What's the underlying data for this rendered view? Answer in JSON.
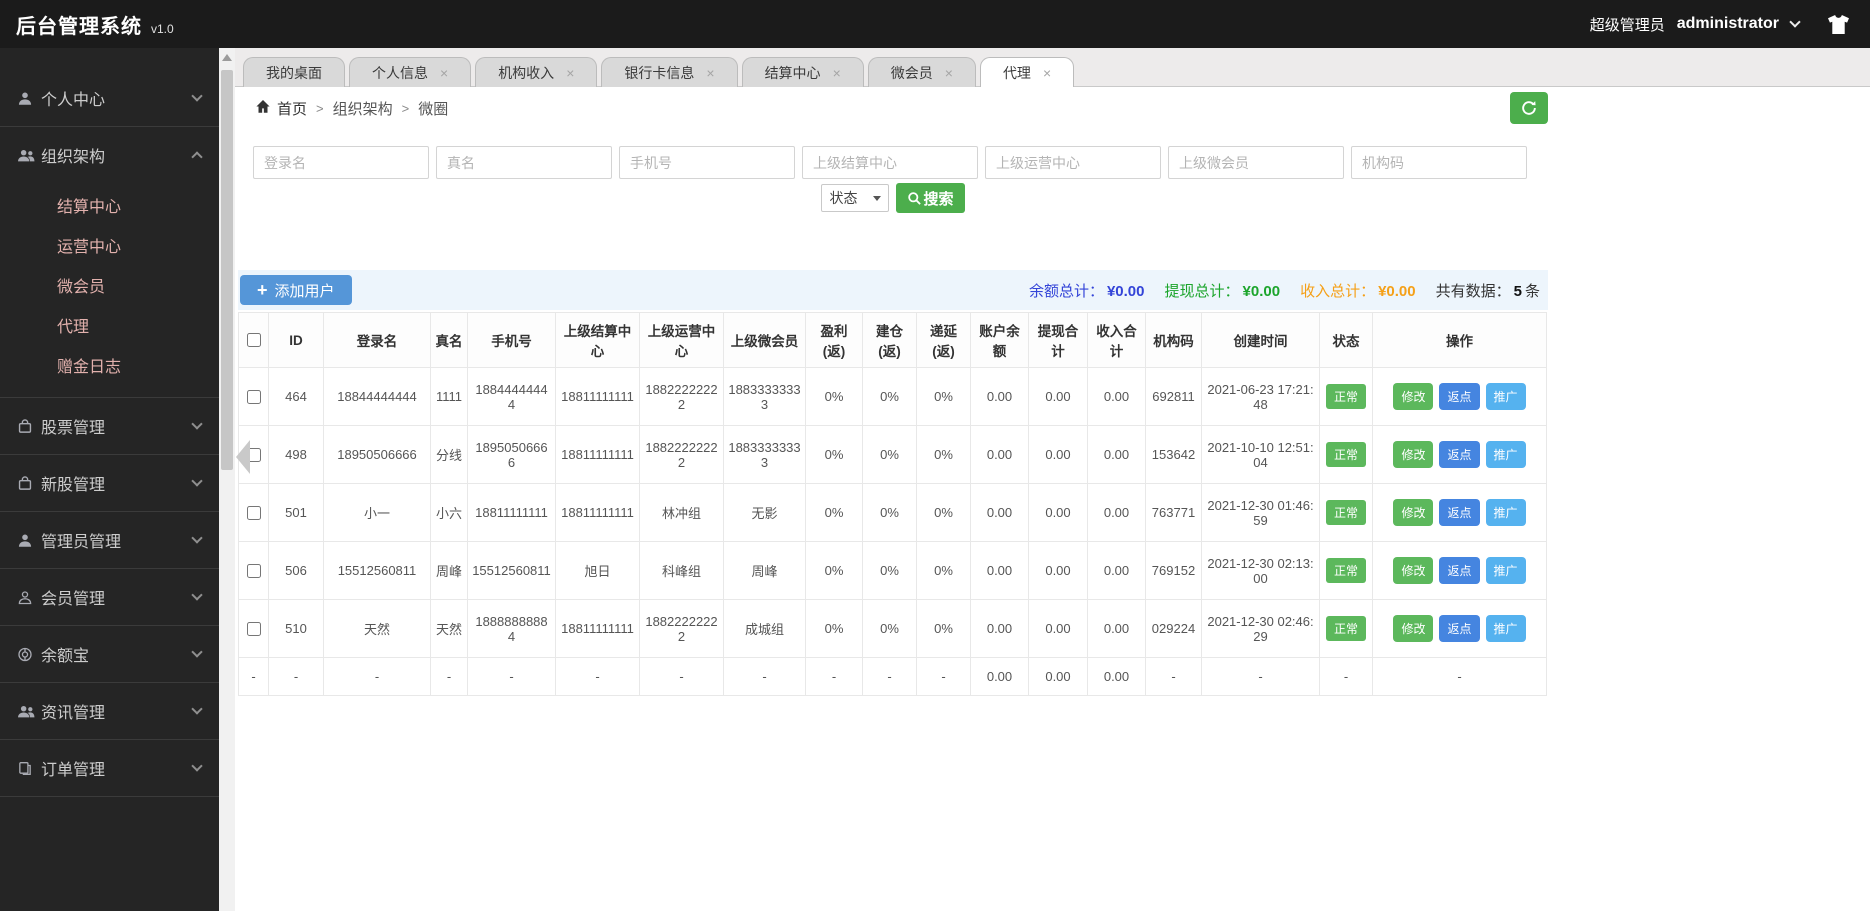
{
  "header": {
    "title": "后台管理系统",
    "version": "v1.0",
    "role": "超级管理员",
    "username": "administrator"
  },
  "sidebar": {
    "items": [
      {
        "label": "个人中心",
        "icon": "user-icon",
        "expanded": false
      },
      {
        "label": "组织架构",
        "icon": "users-icon",
        "expanded": true,
        "children": [
          "结算中心",
          "运营中心",
          "微会员",
          "代理",
          "赠金日志"
        ]
      },
      {
        "label": "股票管理",
        "icon": "bag-icon",
        "expanded": false
      },
      {
        "label": "新股管理",
        "icon": "bag-icon",
        "expanded": false
      },
      {
        "label": "管理员管理",
        "icon": "admin-user-icon",
        "expanded": false
      },
      {
        "label": "会员管理",
        "icon": "member-icon",
        "expanded": false
      },
      {
        "label": "余额宝",
        "icon": "wallet-icon",
        "expanded": false
      },
      {
        "label": "资讯管理",
        "icon": "news-icon",
        "expanded": false
      },
      {
        "label": "订单管理",
        "icon": "order-icon",
        "expanded": false
      }
    ]
  },
  "tabs": {
    "items": [
      {
        "label": "我的桌面",
        "closable": false,
        "active": false
      },
      {
        "label": "个人信息",
        "closable": true,
        "active": false
      },
      {
        "label": "机构收入",
        "closable": true,
        "active": false
      },
      {
        "label": "银行卡信息",
        "closable": true,
        "active": false
      },
      {
        "label": "结算中心",
        "closable": true,
        "active": false
      },
      {
        "label": "微会员",
        "closable": true,
        "active": false
      },
      {
        "label": "代理",
        "closable": true,
        "active": true
      }
    ]
  },
  "breadcrumb": {
    "home": "首页",
    "items": [
      "组织架构",
      "微圈"
    ]
  },
  "filters": {
    "placeholders": [
      "登录名",
      "真名",
      "手机号",
      "上级结算中心",
      "上级运营中心",
      "上级微会员",
      "机构码"
    ],
    "status_label": "状态",
    "search_label": "搜索"
  },
  "toolbar": {
    "add_user_plus": "+",
    "add_user_label": "添加用户",
    "stats": [
      {
        "label": "余额总计：",
        "value": "¥0.00",
        "color": "#3344d8"
      },
      {
        "label": "提现总计：",
        "value": "¥0.00",
        "color": "#1ca52c"
      },
      {
        "label": "收入总计：",
        "value": "¥0.00",
        "color": "#f5a018"
      }
    ],
    "total": {
      "label": "共有数据：",
      "value": "5",
      "unit": "条"
    }
  },
  "table": {
    "headers": [
      "ID",
      "登录名",
      "真名",
      "手机号",
      "上级结算中心",
      "上级运营中心",
      "上级微会员",
      "盈利(返)",
      "建仓(返)",
      "递延(返)",
      "账户余额",
      "提现合计",
      "收入合计",
      "机构码",
      "创建时间",
      "状态",
      "操作"
    ],
    "action_labels": [
      "修改",
      "返点",
      "推广"
    ],
    "rows": [
      {
        "id": "464",
        "login_name": "18844444444",
        "real_name": "1111",
        "phone": "18844444444",
        "parent_settlement": "18811111111",
        "parent_operation": "18822222222",
        "parent_member": "18833333333",
        "profit_rebate": "0%",
        "position_rebate": "0%",
        "defer_rebate": "0%",
        "account_balance": "0.00",
        "withdraw_total": "0.00",
        "income_total": "0.00",
        "org_code": "692811",
        "created_at": "2021-06-23 17:21:48",
        "status": "正常"
      },
      {
        "id": "498",
        "login_name": "18950506666",
        "real_name": "分线",
        "phone": "18950506666",
        "parent_settlement": "18811111111",
        "parent_operation": "18822222222",
        "parent_member": "18833333333",
        "profit_rebate": "0%",
        "position_rebate": "0%",
        "defer_rebate": "0%",
        "account_balance": "0.00",
        "withdraw_total": "0.00",
        "income_total": "0.00",
        "org_code": "153642",
        "created_at": "2021-10-10 12:51:04",
        "status": "正常"
      },
      {
        "id": "501",
        "login_name": "小一",
        "real_name": "小六",
        "phone": "18811111111",
        "parent_settlement": "18811111111",
        "parent_operation": "林冲组",
        "parent_member": "无影",
        "profit_rebate": "0%",
        "position_rebate": "0%",
        "defer_rebate": "0%",
        "account_balance": "0.00",
        "withdraw_total": "0.00",
        "income_total": "0.00",
        "org_code": "763771",
        "created_at": "2021-12-30 01:46:59",
        "status": "正常"
      },
      {
        "id": "506",
        "login_name": "15512560811",
        "real_name": "周峰",
        "phone": "15512560811",
        "parent_settlement": "旭日",
        "parent_operation": "科峰组",
        "parent_member": "周峰",
        "profit_rebate": "0%",
        "position_rebate": "0%",
        "defer_rebate": "0%",
        "account_balance": "0.00",
        "withdraw_total": "0.00",
        "income_total": "0.00",
        "org_code": "769152",
        "created_at": "2021-12-30 02:13:00",
        "status": "正常"
      },
      {
        "id": "510",
        "login_name": "天然",
        "real_name": "天然",
        "phone": "18888888884",
        "parent_settlement": "18811111111",
        "parent_operation": "18822222222",
        "parent_member": "成城组",
        "profit_rebate": "0%",
        "position_rebate": "0%",
        "defer_rebate": "0%",
        "account_balance": "0.00",
        "withdraw_total": "0.00",
        "income_total": "0.00",
        "org_code": "029224",
        "created_at": "2021-12-30 02:46:29",
        "status": "正常"
      }
    ],
    "footer": [
      "-",
      "-",
      "-",
      "-",
      "-",
      "-",
      "-",
      "-",
      "-",
      "-",
      "-",
      "0.00",
      "0.00",
      "0.00",
      "-",
      "-",
      "-",
      "-"
    ]
  },
  "colors": {
    "accent_green": "#4cae4c",
    "accent_blue": "#5596d8",
    "badge_green": "#5cb85c",
    "action_blue": "#4585e0",
    "action_sky": "#55b2ef",
    "toolbar_bg": "#edf5fc"
  }
}
